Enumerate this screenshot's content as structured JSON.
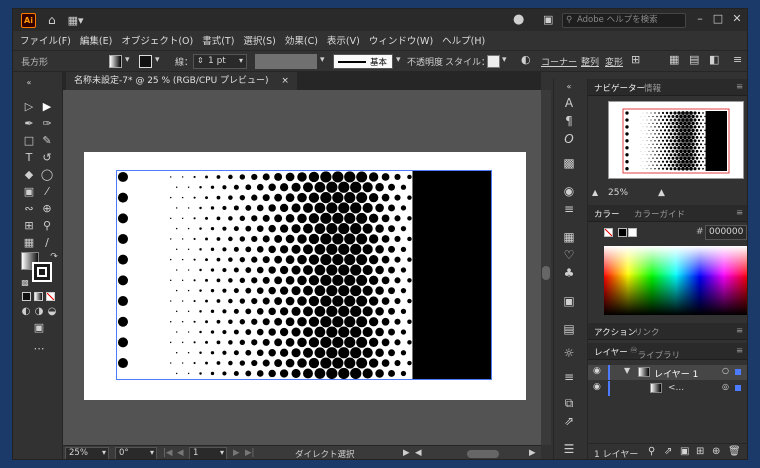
{
  "app": {
    "logo": "Ai",
    "home_icon": "home-icon",
    "accent": "#ff9a00"
  },
  "search": {
    "placeholder": "Adobe ヘルプを検索"
  },
  "menu": [
    "ファイル(F)",
    "編集(E)",
    "オブジェクト(O)",
    "書式(T)",
    "選択(S)",
    "効果(C)",
    "表示(V)",
    "ウィンドウ(W)",
    "ヘルプ(H)"
  ],
  "control": {
    "object_type": "長方形",
    "stroke_label": "線：",
    "stroke_value": "1 pt",
    "brush_label": "基本",
    "opacity_label": "不透明度",
    "style_label": "スタイル：",
    "corner_label": "コーナー",
    "align_label": "整列",
    "transform_label": "変形"
  },
  "document": {
    "tab_title": "名称未設定-7* @ 25 % (RGB/CPU プレビュー)",
    "close": "×"
  },
  "status": {
    "zoom": "25%",
    "rotate": "0°",
    "page": "1",
    "tool": "ダイレクト選択"
  },
  "navigator": {
    "tab_active": "ナビゲーター",
    "tab_other": "情報",
    "zoom": "25%"
  },
  "color": {
    "tab_active": "カラー",
    "tab_other": "カラーガイド",
    "hex_prefix": "#",
    "hex": "000000"
  },
  "actions": {
    "tab_active": "アクション",
    "tab_other": "リンク"
  },
  "layers": {
    "tab_active": "レイヤー",
    "tab_other": "ライブラリ",
    "layer_name": "レイヤー 1",
    "sublayer_name": "<...",
    "footer": "1 レイヤー",
    "layer_color": "#4d7bff"
  },
  "artwork": {
    "description_shown": "halftone",
    "fill": "#000000",
    "background": "#ffffff"
  }
}
